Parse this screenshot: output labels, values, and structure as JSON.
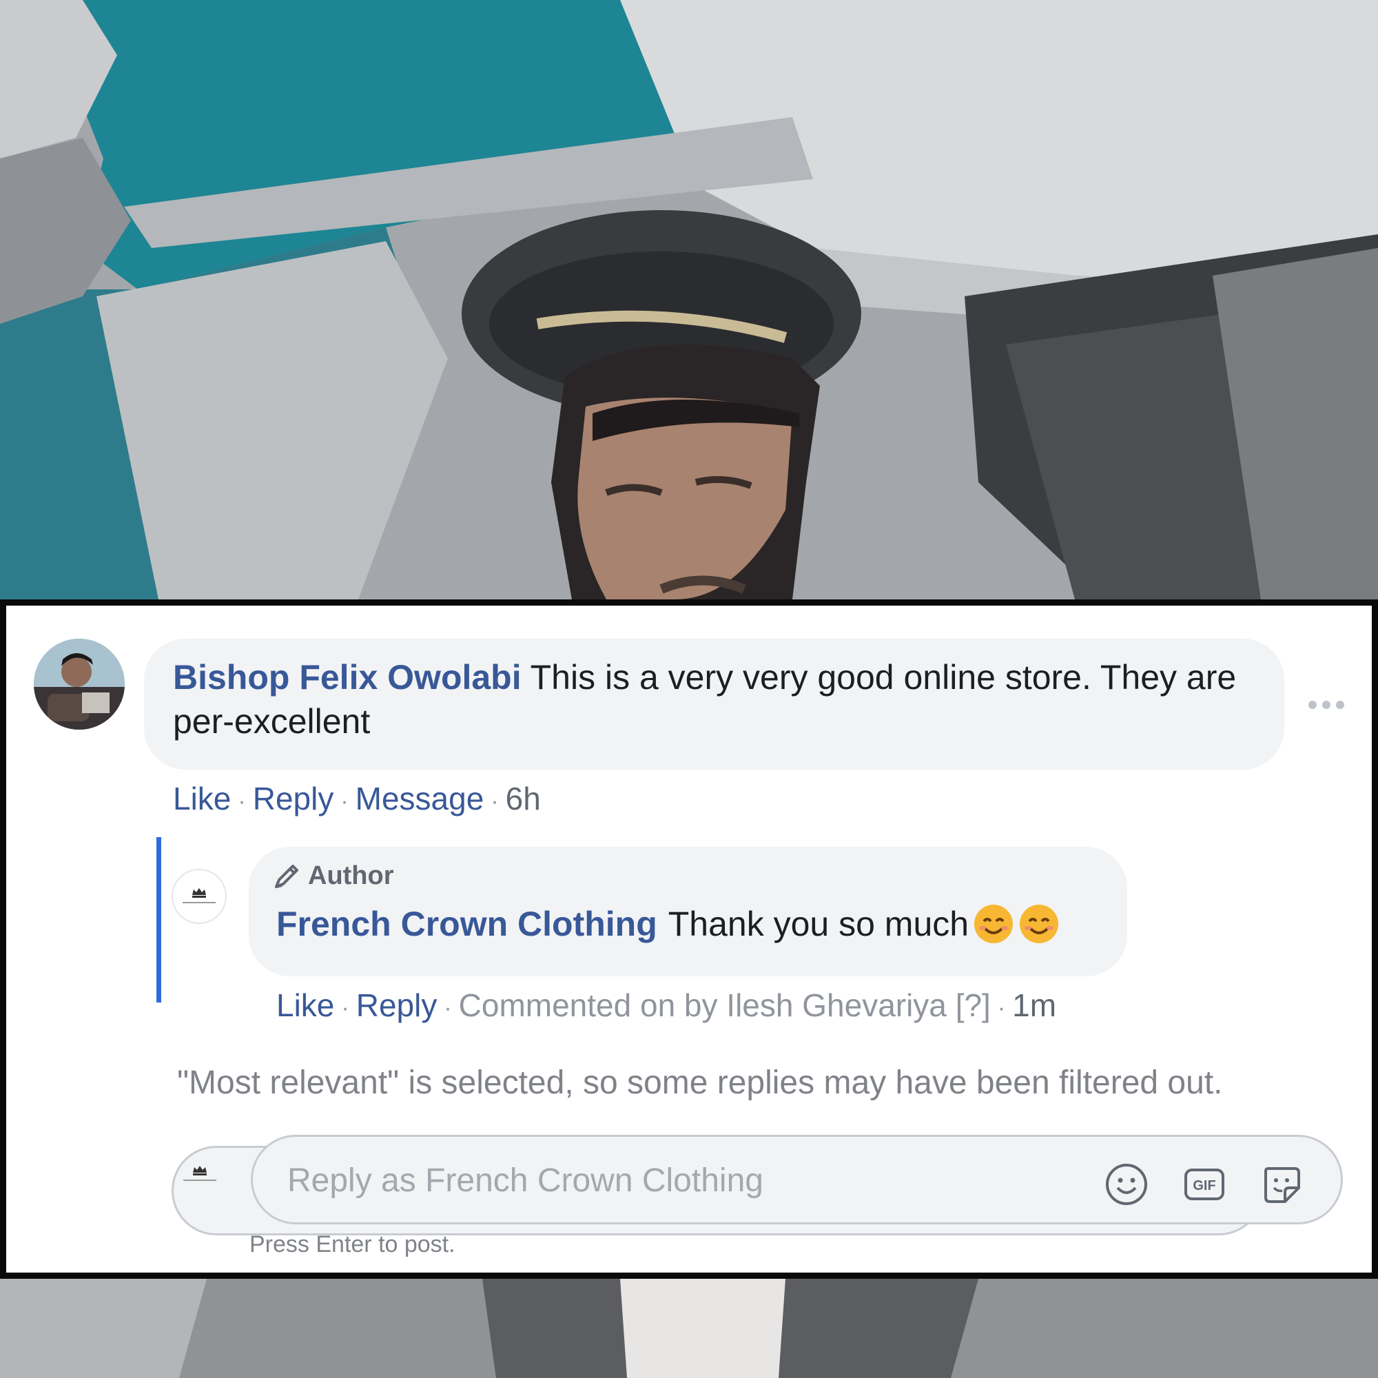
{
  "comment": {
    "author": "Bishop Felix Owolabi",
    "text": "This is a very very good online store. They are per-excellent",
    "actions": {
      "like": "Like",
      "reply": "Reply",
      "message": "Message",
      "time": "6h"
    }
  },
  "reply": {
    "badge": "Author",
    "author": "French Crown Clothing",
    "text": "Thank you so much",
    "emoji_count": 2,
    "actions": {
      "like": "Like",
      "reply": "Reply",
      "commented_by": "Commented on by Ilesh Ghevariya",
      "help": "[?]",
      "time": "1m"
    }
  },
  "filter_note": "\"Most relevant\" is selected, so some replies may have been filtered out.",
  "composer": {
    "placeholder": "Reply as French Crown Clothing",
    "hint": "Press Enter to post.",
    "icons": [
      "smiley-icon",
      "gif-icon",
      "sticker-icon"
    ]
  },
  "colors": {
    "link": "#385898",
    "thread_line": "#2d6cdf",
    "bubble": "#f2f3f5",
    "muted": "#7f8288"
  }
}
